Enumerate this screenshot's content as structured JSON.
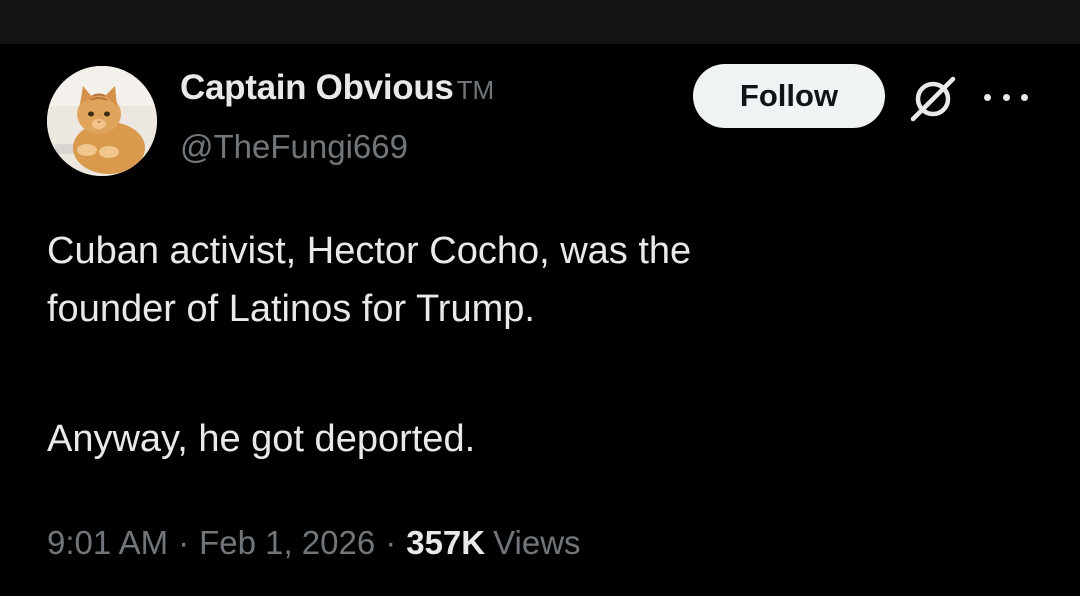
{
  "author": {
    "display_name": "Captain Obvious",
    "badge": "TM",
    "handle": "@TheFungi669",
    "avatar_icon": "orange-cat-avatar"
  },
  "actions": {
    "follow_label": "Follow",
    "grok_icon": "grok-icon",
    "more_icon": "more-options-icon"
  },
  "tweet": {
    "line1": "Cuban activist, Hector Cocho, was the",
    "line2": "founder of Latinos for Trump.",
    "line3": "Anyway, he got deported."
  },
  "meta": {
    "time": "9:01 AM",
    "separator": "·",
    "date": "Feb 1, 2026",
    "views_count": "357K",
    "views_label": "Views"
  },
  "colors": {
    "background": "#000000",
    "top_bar": "#141414",
    "primary_text": "#e7e9ea",
    "secondary_text": "#71767b",
    "follow_bg": "#eff3f4",
    "follow_text": "#0f1419"
  }
}
